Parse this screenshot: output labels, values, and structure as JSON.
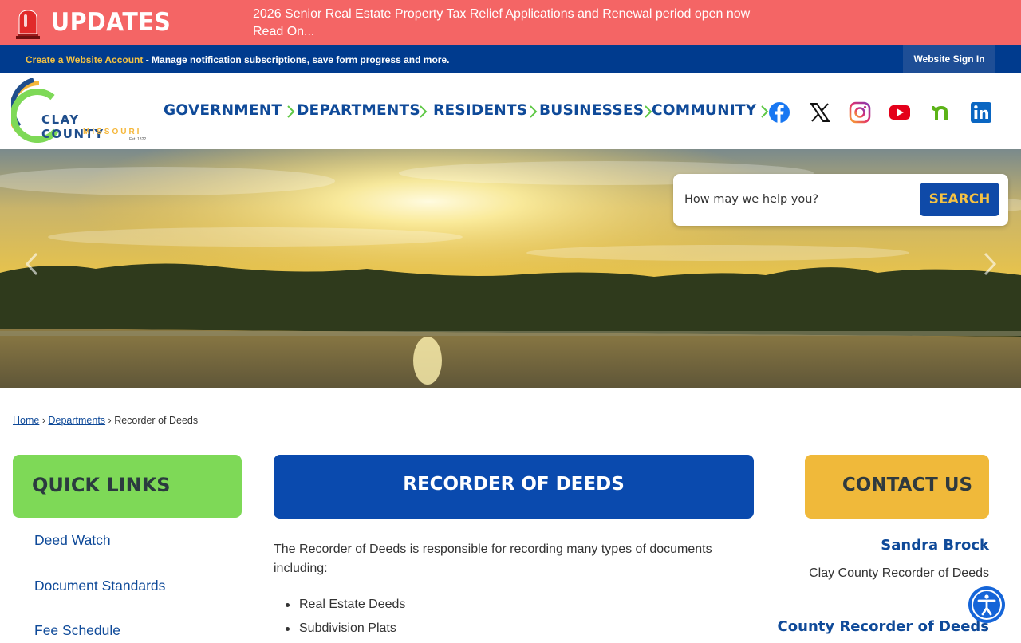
{
  "alert": {
    "title": "UPDATES",
    "message": "2026 Senior Real Estate Property Tax Relief Applications and Renewal period open now",
    "read_more": "Read On...",
    "icon": "siren-icon"
  },
  "account_bar": {
    "create_link": "Create a Website Account",
    "description": " - Manage notification subscriptions, save form progress and more.",
    "sign_in": "Website Sign In"
  },
  "logo": {
    "name": "CLAY COUNTY",
    "state": "MISSOURI",
    "est": "Est. 1822"
  },
  "nav": {
    "items": [
      "GOVERNMENT",
      "DEPARTMENTS",
      "RESIDENTS",
      "BUSINESSES",
      "COMMUNITY"
    ]
  },
  "social": [
    "facebook-icon",
    "x-icon",
    "instagram-icon",
    "youtube-icon",
    "nextdoor-icon",
    "linkedin-icon"
  ],
  "search": {
    "placeholder": "How may we help you?",
    "button": "SEARCH"
  },
  "breadcrumb": {
    "home": "Home",
    "departments": "Departments",
    "current": "Recorder of Deeds",
    "separator": "›"
  },
  "quick_links": {
    "title": "QUICK LINKS",
    "links": [
      "Deed Watch",
      "Document Standards",
      "Fee Schedule"
    ]
  },
  "main": {
    "title": "RECORDER OF DEEDS",
    "intro": "The Recorder of Deeds is responsible for recording many types of documents including:",
    "items": [
      "Real Estate Deeds",
      "Subdivision Plats"
    ]
  },
  "contact": {
    "title": "CONTACT US",
    "name": "Sandra Brock",
    "role": "Clay County Recorder of Deeds",
    "office": "County Recorder of Deeds"
  },
  "colors": {
    "alert": "#f46565",
    "navy": "#003b8e",
    "nav_text": "#0f4a99",
    "green": "#7ed957",
    "blue": "#0a4aae",
    "gold": "#f0b93a"
  }
}
